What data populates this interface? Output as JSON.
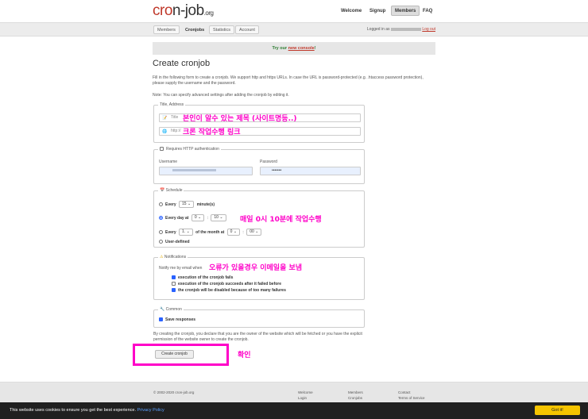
{
  "header": {
    "logo_main": "cr",
    "logo_o": "o",
    "logo_rest": "n-job",
    "logo_tld": ".org",
    "nav": [
      "Welcome",
      "Signup",
      "Members",
      "FAQ"
    ]
  },
  "subnav": {
    "tabs": [
      "Members",
      "Cronjobs",
      "Statistics",
      "Account"
    ],
    "logged_in_prefix": "Logged in as",
    "logout": "Log out"
  },
  "banner": {
    "prefix": "Try our",
    "link": "new console",
    "suffix": "!"
  },
  "page": {
    "title": "Create cronjob",
    "intro": "Fill in the following form to create a cronjob. We support http and https URLs. In case the URL is password-protected (e.g. .htaccess password protection), please supply the username and the password.",
    "note": "Note: You can specify advanced settings after adding the cronjob by editing it."
  },
  "title_address": {
    "legend": "Title, Address",
    "title_placeholder": "Title",
    "address_placeholder": "http://",
    "annot_title": "본인이 알수 있는 제목 (사이트명등..)",
    "annot_address": "크론 작업수행 링크"
  },
  "auth": {
    "legend": "Requires HTTP authentication",
    "username_label": "Username",
    "password_label": "Password",
    "password_value": "•••••••"
  },
  "schedule": {
    "legend": "Schedule",
    "every": "Every",
    "every_value": "15",
    "minutes": "minute(s)",
    "every_day_at": "Every day at",
    "hour": "0",
    "minute": "10",
    "every_month_prefix": "Every",
    "month_day": "1.",
    "of_month_at": "of the month at",
    "month_hour": "0",
    "month_minute": "00",
    "user_defined": "User-defined",
    "annot": "매일 0시 10분에 작업수행"
  },
  "notifications": {
    "legend": "Notifications",
    "notify_label": "Notify me by email when",
    "options": [
      {
        "label": "execution of the cronjob fails",
        "checked": true
      },
      {
        "label": "execution of the cronjob succeeds after it failed before",
        "checked": false
      },
      {
        "label": "the cronjob will be disabled because of too many failures",
        "checked": true
      }
    ],
    "annot": "오류가 있을경우 이메일을 보냄"
  },
  "common": {
    "legend": "Common",
    "save_responses": "Save responses"
  },
  "declare": "By creating the cronjob, you declare that you are the owner of the website which will be fetched or you have the explicit permission of the website owner to create the cronjob.",
  "create_button": "Create cronjob",
  "confirm_annot": "확인",
  "footer": {
    "copyright": "© 2002-2020 cron-job.org",
    "col1_title": "Welcome",
    "col1_item": "Login",
    "col2_title": "Members",
    "col2_item": "Cronjobs",
    "col3_title": "Contact",
    "col3_item": "Terms of Service"
  },
  "cookie": {
    "text": "This website uses cookies to ensure you get the best experience.",
    "link": "Privacy Policy",
    "button": "Got it!"
  },
  "colors": {
    "accent": "#c0392b",
    "annotation": "#ff00c8",
    "cookie_button": "#f5c400"
  }
}
